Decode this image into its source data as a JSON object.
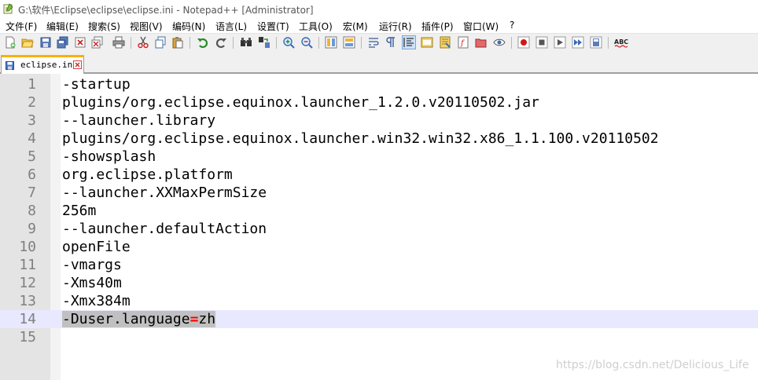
{
  "window": {
    "title": "G:\\软件\\Eclipse\\eclipse\\eclipse.ini - Notepad++ [Administrator]"
  },
  "menu": [
    "文件(F)",
    "编辑(E)",
    "搜索(S)",
    "视图(V)",
    "编码(N)",
    "语言(L)",
    "设置(T)",
    "工具(O)",
    "宏(M)",
    "运行(R)",
    "插件(P)",
    "窗口(W)",
    "?"
  ],
  "tab": {
    "label": "eclipse.ini"
  },
  "editor": {
    "lines": [
      {
        "num": "1",
        "text": "-startup"
      },
      {
        "num": "2",
        "text": "plugins/org.eclipse.equinox.launcher_1.2.0.v20110502.jar"
      },
      {
        "num": "3",
        "text": "--launcher.library"
      },
      {
        "num": "4",
        "text": "plugins/org.eclipse.equinox.launcher.win32.win32.x86_1.1.100.v20110502"
      },
      {
        "num": "5",
        "text": "-showsplash"
      },
      {
        "num": "6",
        "text": "org.eclipse.platform"
      },
      {
        "num": "7",
        "text": "--launcher.XXMaxPermSize"
      },
      {
        "num": "8",
        "text": "256m"
      },
      {
        "num": "9",
        "text": "--launcher.defaultAction"
      },
      {
        "num": "10",
        "text": "openFile"
      },
      {
        "num": "11",
        "text": "-vmargs"
      },
      {
        "num": "12",
        "text": "-Xms40m"
      },
      {
        "num": "13",
        "text": "-Xmx384m"
      },
      {
        "num": "14",
        "text_before": "-Duser.language",
        "text_op": "=",
        "text_after": "zh"
      },
      {
        "num": "15",
        "text": ""
      }
    ]
  },
  "watermark": "https://blog.csdn.net/Delicious_Life",
  "colors": {
    "current_line": "#e8e8ff",
    "selection": "#c0c0c0",
    "operator": "#ff0000",
    "tab_accent": "#fab100"
  }
}
